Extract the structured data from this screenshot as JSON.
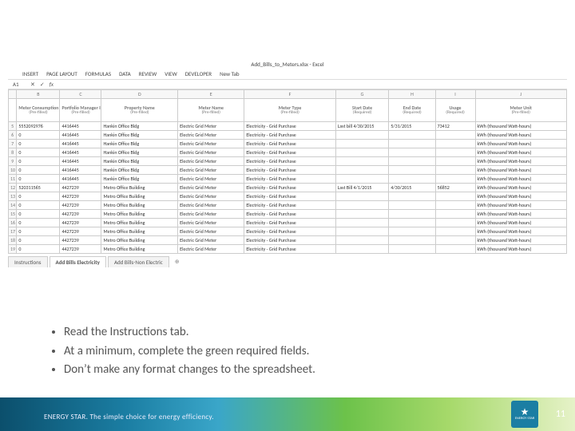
{
  "excel": {
    "workbook_title": "Add_Bills_to_Meters.xlsx - Excel",
    "ribbon": [
      "INSERT",
      "PAGE LAYOUT",
      "FORMULAS",
      "DATA",
      "REVIEW",
      "VIEW",
      "DEVELOPER",
      "New Tab"
    ],
    "name_box": "A1",
    "col_letters": [
      "B",
      "C",
      "D",
      "E",
      "F",
      "G",
      "H",
      "I",
      "J"
    ],
    "headers": [
      {
        "title": "Meter Consumption ID",
        "sub": "(Pre-filled)"
      },
      {
        "title": "Portfolio Manager ID",
        "sub": "(Pre-filled)"
      },
      {
        "title": "Property Name",
        "sub": "(Pre-filled)"
      },
      {
        "title": "Meter Name",
        "sub": "(Pre-filled)"
      },
      {
        "title": "Meter Type",
        "sub": "(Pre-filled)"
      },
      {
        "title": "Start Date",
        "sub": "(Required)"
      },
      {
        "title": "End Date",
        "sub": "(Required)"
      },
      {
        "title": "Usage",
        "sub": "(Required)"
      },
      {
        "title": "Meter Unit",
        "sub": "(Pre-filled)"
      }
    ],
    "rows": [
      {
        "n": "5",
        "mcid": "5552092976",
        "pmid": "4416445",
        "prop": "Hankin Office Bldg",
        "meter": "Electric Grid Meter",
        "type": "Electricity - Grid Purchase",
        "sd": "Last bill 4/30/2015",
        "ed": "5/31/2015",
        "usg": "73412",
        "unit": "kWh (thousand Watt-hours)"
      },
      {
        "n": "6",
        "mcid": "0",
        "pmid": "4416445",
        "prop": "Hankin Office Bldg",
        "meter": "Electric Grid Meter",
        "type": "Electricity - Grid Purchase",
        "sd": "",
        "ed": "",
        "usg": "",
        "unit": "kWh (thousand Watt-hours)"
      },
      {
        "n": "7",
        "mcid": "0",
        "pmid": "4416445",
        "prop": "Hankin Office Bldg",
        "meter": "Electric Grid Meter",
        "type": "Electricity - Grid Purchase",
        "sd": "",
        "ed": "",
        "usg": "",
        "unit": "kWh (thousand Watt-hours)"
      },
      {
        "n": "8",
        "mcid": "0",
        "pmid": "4416445",
        "prop": "Hankin Office Bldg",
        "meter": "Electric Grid Meter",
        "type": "Electricity - Grid Purchase",
        "sd": "",
        "ed": "",
        "usg": "",
        "unit": "kWh (thousand Watt-hours)"
      },
      {
        "n": "9",
        "mcid": "0",
        "pmid": "4416445",
        "prop": "Hankin Office Bldg",
        "meter": "Electric Grid Meter",
        "type": "Electricity - Grid Purchase",
        "sd": "",
        "ed": "",
        "usg": "",
        "unit": "kWh (thousand Watt-hours)"
      },
      {
        "n": "10",
        "mcid": "0",
        "pmid": "4416445",
        "prop": "Hankin Office Bldg",
        "meter": "Electric Grid Meter",
        "type": "Electricity - Grid Purchase",
        "sd": "",
        "ed": "",
        "usg": "",
        "unit": "kWh (thousand Watt-hours)"
      },
      {
        "n": "11",
        "mcid": "0",
        "pmid": "4416445",
        "prop": "Hankin Office Bldg",
        "meter": "Electric Grid Meter",
        "type": "Electricity - Grid Purchase",
        "sd": "",
        "ed": "",
        "usg": "",
        "unit": "kWh (thousand Watt-hours)"
      },
      {
        "n": "12",
        "mcid": "520311565",
        "pmid": "4427239",
        "prop": "Metro Office Building",
        "meter": "Electric Grid Meter",
        "type": "Electricity - Grid Purchase",
        "sd": "Last Bill 4/1/2015",
        "ed": "4/30/2015",
        "usg": "56852",
        "unit": "kWh (thousand Watt-hours)"
      },
      {
        "n": "13",
        "mcid": "0",
        "pmid": "4427239",
        "prop": "Metro Office Building",
        "meter": "Electric Grid Meter",
        "type": "Electricity - Grid Purchase",
        "sd": "",
        "ed": "",
        "usg": "",
        "unit": "kWh (thousand Watt-hours)"
      },
      {
        "n": "14",
        "mcid": "0",
        "pmid": "4427239",
        "prop": "Metro Office Building",
        "meter": "Electric Grid Meter",
        "type": "Electricity - Grid Purchase",
        "sd": "",
        "ed": "",
        "usg": "",
        "unit": "kWh (thousand Watt-hours)"
      },
      {
        "n": "15",
        "mcid": "0",
        "pmid": "4427239",
        "prop": "Metro Office Building",
        "meter": "Electric Grid Meter",
        "type": "Electricity - Grid Purchase",
        "sd": "",
        "ed": "",
        "usg": "",
        "unit": "kWh (thousand Watt-hours)"
      },
      {
        "n": "16",
        "mcid": "0",
        "pmid": "4427239",
        "prop": "Metro Office Building",
        "meter": "Electric Grid Meter",
        "type": "Electricity - Grid Purchase",
        "sd": "",
        "ed": "",
        "usg": "",
        "unit": "kWh (thousand Watt-hours)"
      },
      {
        "n": "17",
        "mcid": "0",
        "pmid": "4427239",
        "prop": "Metro Office Building",
        "meter": "Electric Grid Meter",
        "type": "Electricity - Grid Purchase",
        "sd": "",
        "ed": "",
        "usg": "",
        "unit": "kWh (thousand Watt-hours)"
      },
      {
        "n": "18",
        "mcid": "0",
        "pmid": "4427239",
        "prop": "Metro Office Building",
        "meter": "Electric Grid Meter",
        "type": "Electricity - Grid Purchase",
        "sd": "",
        "ed": "",
        "usg": "",
        "unit": "kWh (thousand Watt-hours)"
      },
      {
        "n": "19",
        "mcid": "0",
        "pmid": "4427239",
        "prop": "Metro Office Building",
        "meter": "Electric Grid Meter",
        "type": "Electricity - Grid Purchase",
        "sd": "",
        "ed": "",
        "usg": "",
        "unit": "kWh (thousand Watt-hours)"
      }
    ],
    "sheet_tabs": [
      "Instructions",
      "Add Bills Electricity",
      "Add Bills-Non Electric"
    ]
  },
  "bullets": [
    "Read the Instructions tab.",
    "At a minimum, complete the green required fields.",
    "Don’t make any format changes to the spreadsheet."
  ],
  "footer": {
    "tagline": "ENERGY STAR. The simple choice for energy efficiency.",
    "logo_text": "ENERGY STAR",
    "page": "11"
  }
}
